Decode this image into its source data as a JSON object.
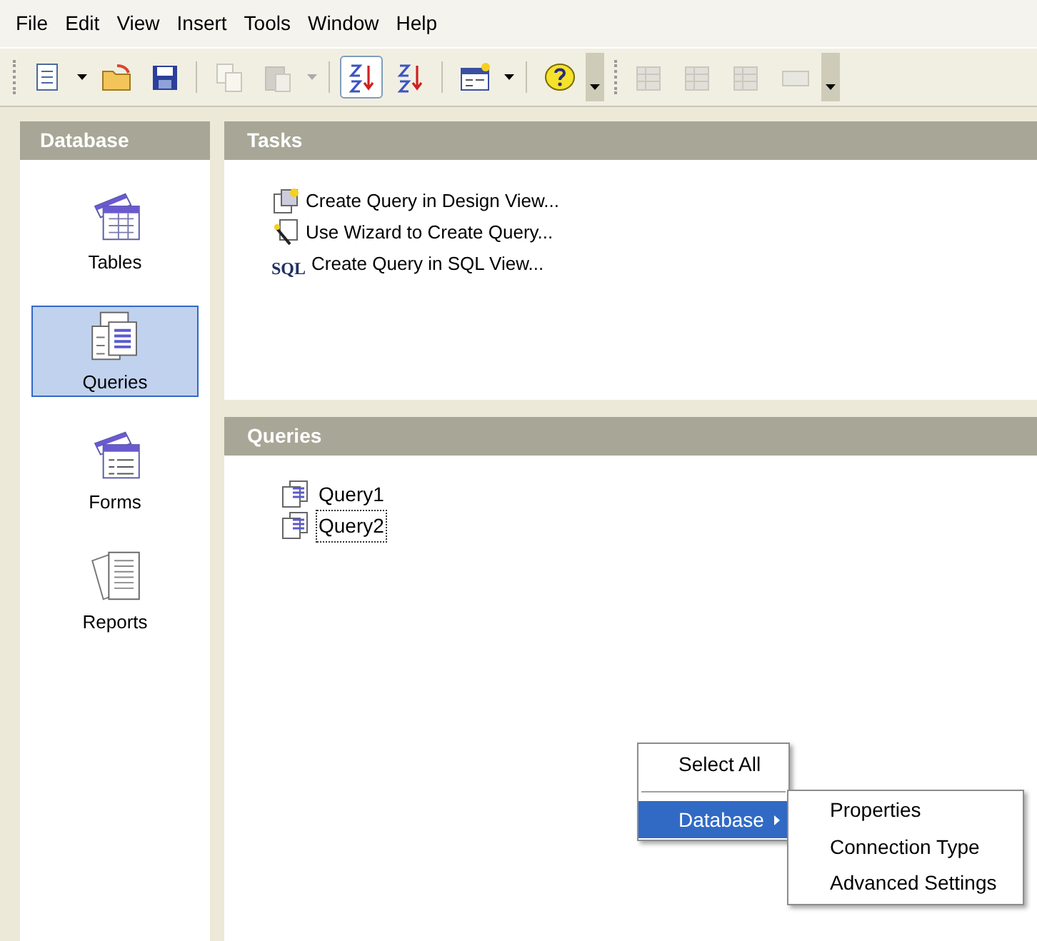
{
  "menu_bar": [
    "File",
    "Edit",
    "View",
    "Insert",
    "Tools",
    "Window",
    "Help"
  ],
  "toolbar": [
    {
      "kind": "grip"
    },
    {
      "kind": "new",
      "disabled": false
    },
    {
      "kind": "caret",
      "disabled": false
    },
    {
      "kind": "open",
      "disabled": false
    },
    {
      "kind": "save",
      "disabled": false
    },
    {
      "kind": "sep"
    },
    {
      "kind": "copy",
      "disabled": true
    },
    {
      "kind": "paste",
      "disabled": true
    },
    {
      "kind": "caret",
      "disabled": true
    },
    {
      "kind": "sep"
    },
    {
      "kind": "sortasc",
      "disabled": false,
      "pressed": true
    },
    {
      "kind": "sortdesc",
      "disabled": false,
      "pressed": false
    },
    {
      "kind": "sep"
    },
    {
      "kind": "form",
      "disabled": false
    },
    {
      "kind": "caret",
      "disabled": false
    },
    {
      "kind": "sep"
    },
    {
      "kind": "help",
      "disabled": false
    },
    {
      "kind": "overflow"
    },
    {
      "kind": "grip"
    },
    {
      "kind": "doc",
      "disabled": true
    },
    {
      "kind": "doc",
      "disabled": true
    },
    {
      "kind": "doc",
      "disabled": true
    },
    {
      "kind": "field",
      "disabled": true
    },
    {
      "kind": "overflow"
    }
  ],
  "sidebar": {
    "title": "Database",
    "items": [
      {
        "kind": "tables",
        "label": "Tables",
        "selected": false
      },
      {
        "kind": "queries",
        "label": "Queries",
        "selected": true
      },
      {
        "kind": "forms",
        "label": "Forms",
        "selected": false
      },
      {
        "kind": "reports",
        "label": "Reports",
        "selected": false
      }
    ]
  },
  "tasks": {
    "title": "Tasks",
    "items": [
      {
        "kind": "design",
        "label": "Create Query in Design View..."
      },
      {
        "kind": "wizard",
        "label": "Use Wizard to Create Query..."
      },
      {
        "kind": "sql",
        "badge": "SQL",
        "label": "Create Query in SQL View..."
      }
    ]
  },
  "queries": {
    "title": "Queries",
    "items": [
      {
        "label": "Query1",
        "focused": false
      },
      {
        "label": "Query2",
        "focused": true
      }
    ]
  },
  "context_menu": {
    "items": [
      {
        "kind": "item",
        "label": "Select All",
        "selected": false
      },
      {
        "kind": "separator"
      },
      {
        "kind": "submenu",
        "label": "Database",
        "selected": true
      }
    ],
    "submenu": [
      {
        "label": "Properties"
      },
      {
        "label": "Connection Type"
      },
      {
        "label": "Advanced Settings"
      }
    ]
  }
}
